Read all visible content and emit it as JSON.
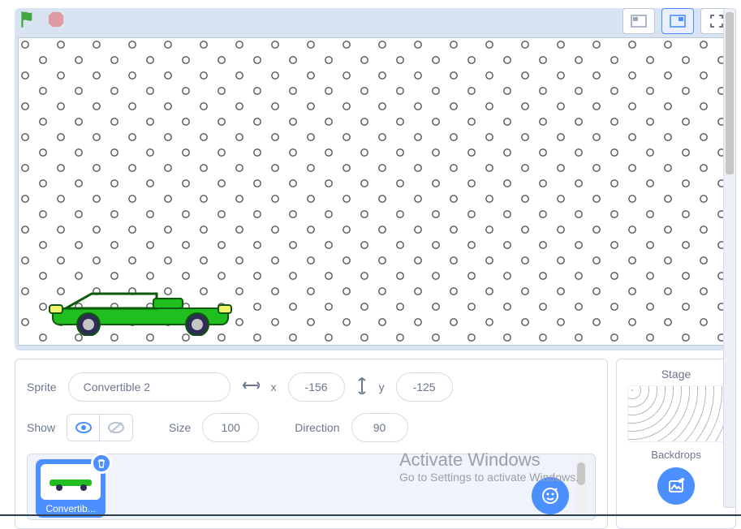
{
  "sprite": {
    "label": "Sprite",
    "name": "Convertible 2",
    "x_label": "x",
    "x_value": "-156",
    "y_label": "y",
    "y_value": "-125",
    "show_label": "Show",
    "size_label": "Size",
    "size_value": "100",
    "direction_label": "Direction",
    "direction_value": "90"
  },
  "thumb": {
    "label": "Convertib..."
  },
  "stage_panel": {
    "title": "Stage",
    "backdrops_label": "Backdrops"
  },
  "watermark": {
    "title": "Activate Windows",
    "subtitle": "Go to Settings to activate Windows."
  }
}
